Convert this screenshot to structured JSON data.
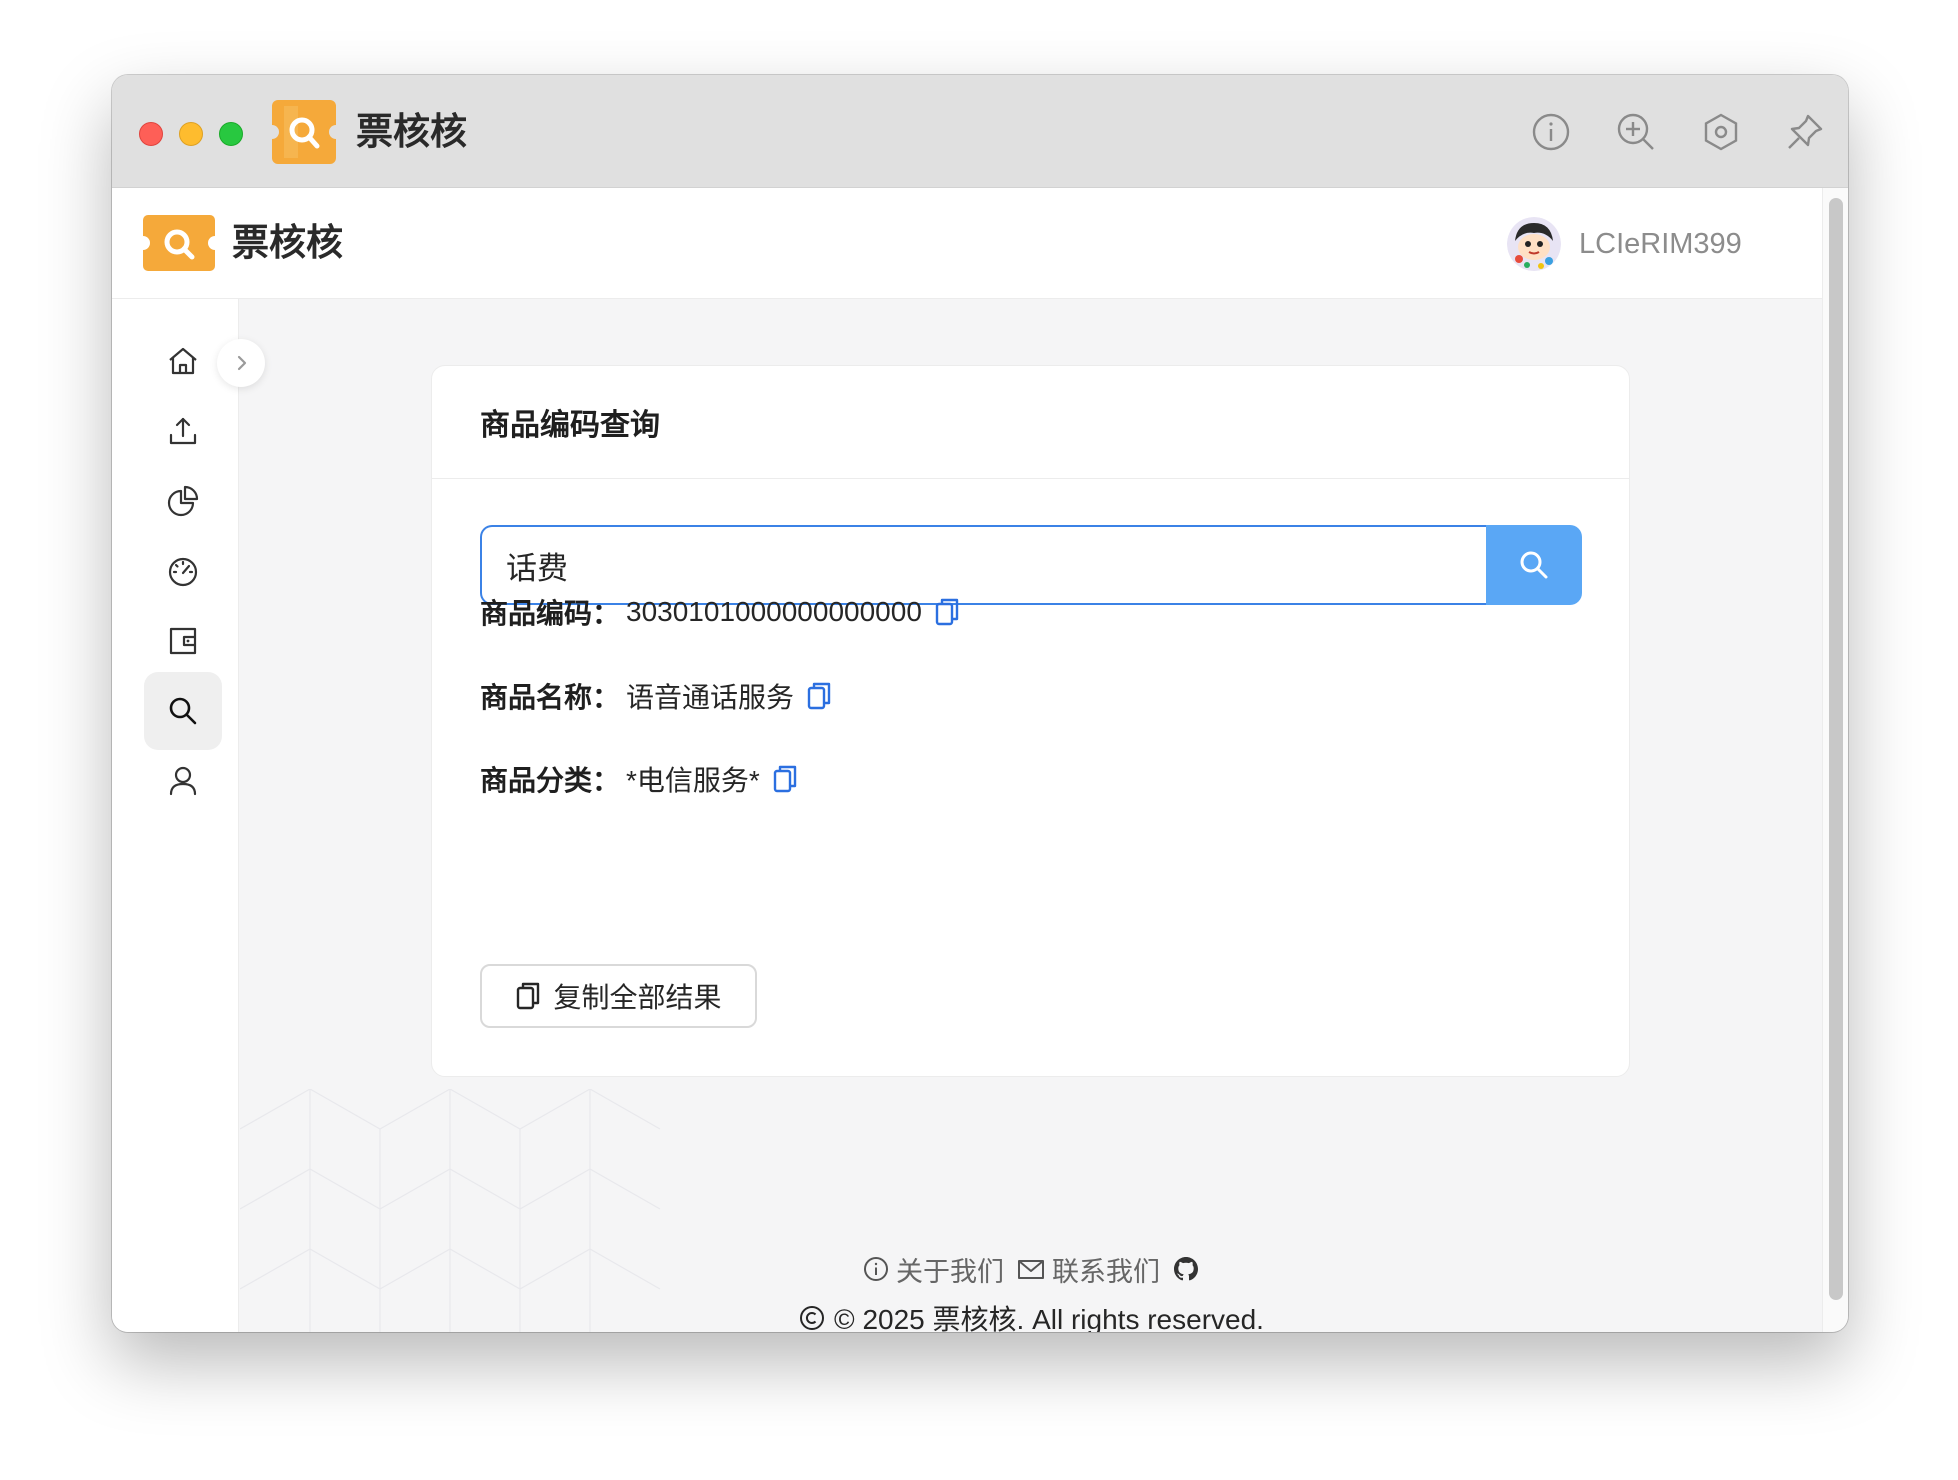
{
  "window": {
    "title": "票核核"
  },
  "titlebar_icons": [
    "info-icon",
    "zoom-in-icon",
    "settings-icon",
    "pin-icon"
  ],
  "header": {
    "app_name": "票核核",
    "username": "LCIeRIM399"
  },
  "sidebar": {
    "items": [
      {
        "name": "home",
        "icon": "home-icon"
      },
      {
        "name": "upload",
        "icon": "upload-icon"
      },
      {
        "name": "statistics",
        "icon": "pie-chart-icon"
      },
      {
        "name": "dashboard",
        "icon": "gauge-icon"
      },
      {
        "name": "wallet",
        "icon": "wallet-icon"
      },
      {
        "name": "search",
        "icon": "search-icon",
        "active": true
      },
      {
        "name": "user",
        "icon": "user-icon"
      }
    ]
  },
  "card": {
    "title": "商品编码查询",
    "search_value": "话费",
    "results": [
      {
        "label": "商品编码：",
        "value": "3030101000000000000"
      },
      {
        "label": "商品名称：",
        "value": "语音通话服务"
      },
      {
        "label": "商品分类：",
        "value": "*电信服务*"
      }
    ],
    "copy_all_label": "复制全部结果"
  },
  "footer": {
    "about": "关于我们",
    "contact": "联系我们",
    "copyright": "© 2025 票核核. All rights reserved."
  },
  "colors": {
    "accent": "#3b82e6",
    "search_button": "#5aa7f5",
    "copy_icon": "#2b6fe0",
    "logo_orange": "#f5a93a"
  }
}
